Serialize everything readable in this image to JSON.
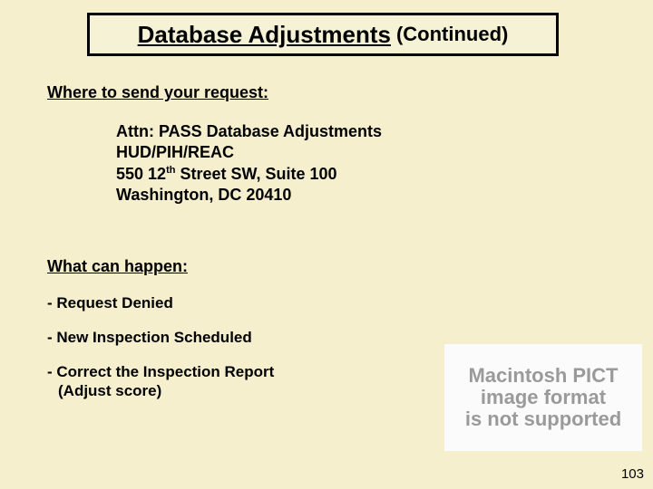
{
  "title": {
    "main": "Database Adjustments",
    "suffix": "(Continued)"
  },
  "headings": {
    "where": "Where to send your request:",
    "what": "What can happen:"
  },
  "address": {
    "line1": "Attn: PASS Database Adjustments",
    "line2": "HUD/PIH/REAC",
    "line3_pre": "550 12",
    "line3_sup": "th",
    "line3_post": " Street SW, Suite 100",
    "line4": "Washington, DC  20410"
  },
  "outcomes": {
    "o1": "- Request Denied",
    "o2": "- New Inspection Scheduled",
    "o3a": "- Correct the Inspection Report",
    "o3b": "(Adjust score)"
  },
  "placeholder": {
    "l1": "Macintosh PICT",
    "l2": "image format",
    "l3": "is not supported"
  },
  "page_number": "103"
}
